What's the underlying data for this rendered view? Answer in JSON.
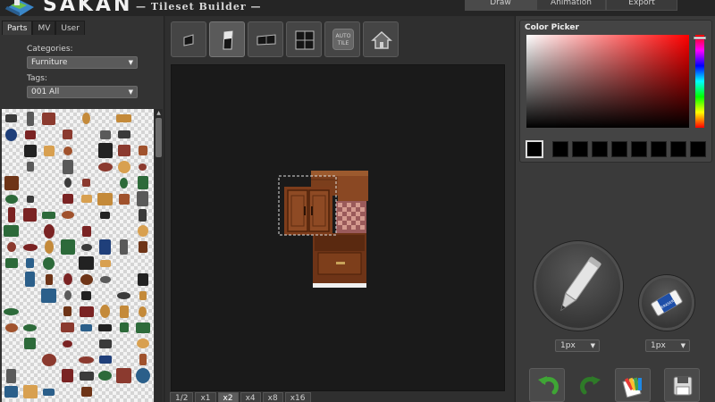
{
  "app": {
    "title": "SAKAN",
    "subtitle": "— Tileset Builder —"
  },
  "mode_tabs": [
    {
      "label": "Draw",
      "active": true
    },
    {
      "label": "Animation",
      "active": false
    },
    {
      "label": "Export",
      "active": false
    }
  ],
  "left_panel": {
    "tabs": [
      {
        "label": "Parts",
        "active": true
      },
      {
        "label": "MV",
        "active": false
      },
      {
        "label": "User",
        "active": false
      }
    ],
    "categories_label": "Categories:",
    "categories_value": "Furniture",
    "tags_label": "Tags:",
    "tags_value": "001 All"
  },
  "toolbar": {
    "tools": [
      {
        "name": "single-tile-tool",
        "icon": "square-icon",
        "active": false
      },
      {
        "name": "vertical-tile-tool",
        "icon": "vertical-rect-icon",
        "active": true
      },
      {
        "name": "horizontal-tile-tool",
        "icon": "horizontal-rect-icon",
        "active": false
      },
      {
        "name": "quad-tile-tool",
        "icon": "grid-icon",
        "active": false
      },
      {
        "name": "auto-tile-tool",
        "icon": "auto-tile-icon",
        "active": false,
        "label_top": "AUTO",
        "label_bottom": "TILE"
      },
      {
        "name": "house-tool",
        "icon": "house-icon",
        "active": false
      }
    ]
  },
  "zoom": {
    "page": "1/2",
    "levels": [
      {
        "label": "x1",
        "active": false
      },
      {
        "label": "x2",
        "active": true
      },
      {
        "label": "x4",
        "active": false
      },
      {
        "label": "x8",
        "active": false
      },
      {
        "label": "x16",
        "active": false
      }
    ]
  },
  "color_picker": {
    "title": "Color Picker",
    "current_color": "#000000",
    "swatches": [
      "#000000",
      "#000000",
      "#000000",
      "#000000",
      "#000000",
      "#000000",
      "#000000",
      "#000000"
    ]
  },
  "pen_size": "1px",
  "eraser_size": "1px",
  "eraser_brand": "ERASER",
  "colors": {
    "accent_red": "#ff0000",
    "undo_green": "#3fa535",
    "wood": "#7a3d1a"
  }
}
